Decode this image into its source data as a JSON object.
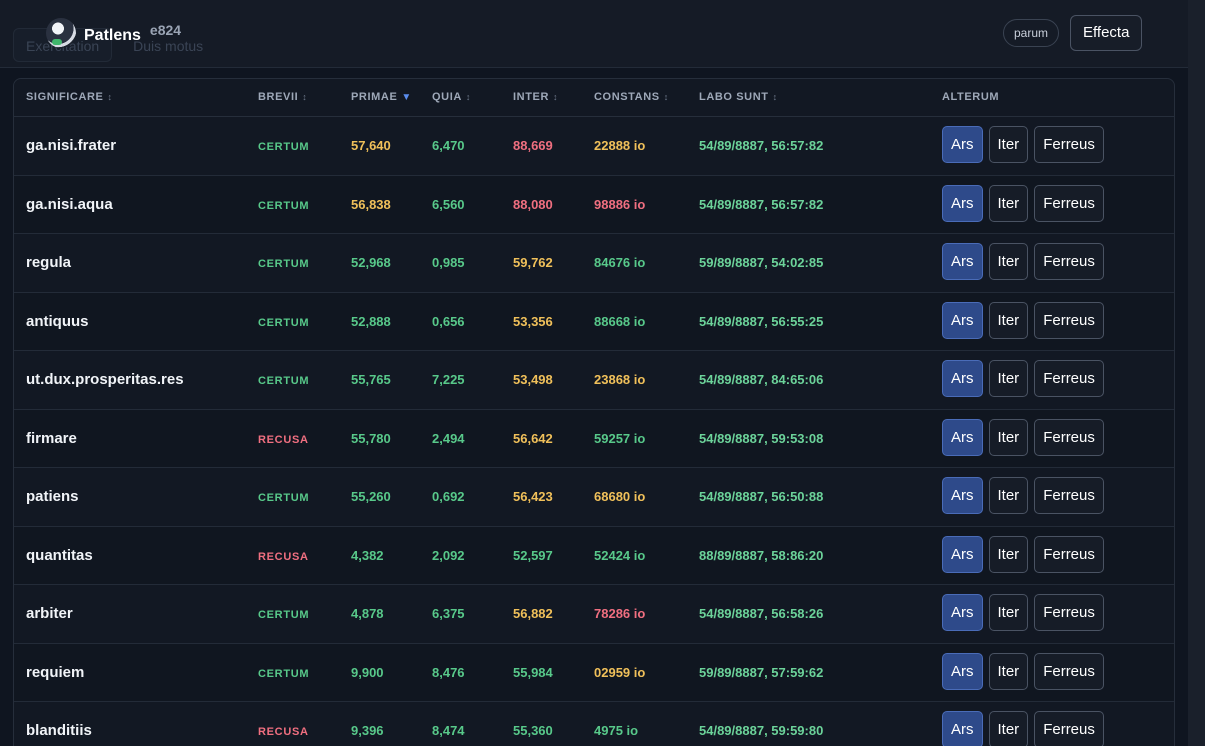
{
  "header": {
    "ghost_tabs": [
      "Exercitation",
      "Duis motus"
    ],
    "brand_name": "Patlens",
    "brand_badge": "e824",
    "pill_label": "parum",
    "action_label": "Effecta"
  },
  "table": {
    "columns": [
      "SIGNIFICARE",
      "BREVII",
      "PRIMAE",
      "QUIA",
      "INTER",
      "CONSTANS",
      "LABO SUNT",
      "ALTERUM"
    ],
    "sort_glyph": "↕",
    "sort_active_glyph": "▼",
    "action_labels": [
      "Ars",
      "Iter",
      "Ferreus"
    ],
    "rows": [
      {
        "name": "ga.nisi.frater",
        "status": "CERTUM",
        "status_color": "green",
        "primae": "57,640",
        "primae_color": "yellow",
        "quia": "6,470",
        "quia_color": "green",
        "inter": "88,669",
        "inter_color": "red",
        "constans": "22888 io",
        "constans_color": "yellow",
        "time": "54/89/8887, 56:57:82"
      },
      {
        "name": "ga.nisi.aqua",
        "status": "CERTUM",
        "status_color": "green",
        "primae": "56,838",
        "primae_color": "yellow",
        "quia": "6,560",
        "quia_color": "green",
        "inter": "88,080",
        "inter_color": "red",
        "constans": "98886 io",
        "constans_color": "red",
        "time": "54/89/8887, 56:57:82"
      },
      {
        "name": "regula",
        "status": "CERTUM",
        "status_color": "green",
        "primae": "52,968",
        "primae_color": "green",
        "quia": "0,985",
        "quia_color": "green",
        "inter": "59,762",
        "inter_color": "yellow",
        "constans": "84676 io",
        "constans_color": "green",
        "time": "59/89/8887, 54:02:85"
      },
      {
        "name": "antiquus",
        "status": "CERTUM",
        "status_color": "green",
        "primae": "52,888",
        "primae_color": "green",
        "quia": "0,656",
        "quia_color": "green",
        "inter": "53,356",
        "inter_color": "yellow",
        "constans": "88668 io",
        "constans_color": "green",
        "time": "54/89/8887, 56:55:25"
      },
      {
        "name": "ut.dux.prosperitas.res",
        "status": "CERTUM",
        "status_color": "green",
        "primae": "55,765",
        "primae_color": "green",
        "quia": "7,225",
        "quia_color": "green",
        "inter": "53,498",
        "inter_color": "yellow",
        "constans": "23868 io",
        "constans_color": "yellow",
        "time": "54/89/8887, 84:65:06"
      },
      {
        "name": "firmare",
        "status": "RECUSA",
        "status_color": "red",
        "primae": "55,780",
        "primae_color": "green",
        "quia": "2,494",
        "quia_color": "green",
        "inter": "56,642",
        "inter_color": "yellow",
        "constans": "59257 io",
        "constans_color": "green",
        "time": "54/89/8887, 59:53:08"
      },
      {
        "name": "patiens",
        "status": "CERTUM",
        "status_color": "green",
        "primae": "55,260",
        "primae_color": "green",
        "quia": "0,692",
        "quia_color": "green",
        "inter": "56,423",
        "inter_color": "yellow",
        "constans": "68680 io",
        "constans_color": "yellow",
        "time": "54/89/8887, 56:50:88"
      },
      {
        "name": "quantitas",
        "status": "RECUSA",
        "status_color": "red",
        "primae": "4,382",
        "primae_color": "green",
        "quia": "2,092",
        "quia_color": "green",
        "inter": "52,597",
        "inter_color": "green",
        "constans": "52424 io",
        "constans_color": "green",
        "time": "88/89/8887, 58:86:20"
      },
      {
        "name": "arbiter",
        "status": "CERTUM",
        "status_color": "green",
        "primae": "4,878",
        "primae_color": "green",
        "quia": "6,375",
        "quia_color": "green",
        "inter": "56,882",
        "inter_color": "yellow",
        "constans": "78286 io",
        "constans_color": "red",
        "time": "54/89/8887, 56:58:26"
      },
      {
        "name": "requiem",
        "status": "CERTUM",
        "status_color": "green",
        "primae": "9,900",
        "primae_color": "green",
        "quia": "8,476",
        "quia_color": "green",
        "inter": "55,984",
        "inter_color": "green",
        "constans": "02959 io",
        "constans_color": "yellow",
        "time": "59/89/8887, 57:59:62"
      },
      {
        "name": "blanditiis",
        "status": "RECUSA",
        "status_color": "red",
        "primae": "9,396",
        "primae_color": "green",
        "quia": "8,474",
        "quia_color": "green",
        "inter": "55,360",
        "inter_color": "green",
        "constans": "4975 io",
        "constans_color": "green",
        "time": "54/89/8887, 59:59:80"
      }
    ]
  }
}
